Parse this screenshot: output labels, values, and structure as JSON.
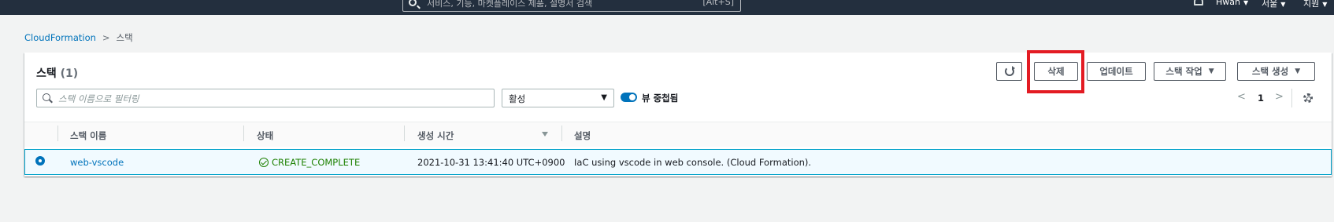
{
  "topnav": {
    "search_placeholder": "서비스, 기능, 마켓플레이스 제품, 설명서 검색",
    "search_shortcut": "[Alt+S]",
    "user": "Hwan",
    "region": "서울",
    "support": "지원"
  },
  "breadcrumb": {
    "root": "CloudFormation",
    "current": "스택"
  },
  "panel": {
    "title": "스택",
    "count": "(1)",
    "buttons": {
      "delete": "삭제",
      "update": "업데이트",
      "stack_actions": "스택 작업",
      "create_stack": "스택 생성"
    },
    "filter_placeholder": "스택 이름으로 필터링",
    "status_filter": "활성",
    "toggle_label": "뷰 중첩됨",
    "page": "1"
  },
  "table": {
    "headers": [
      "스택 이름",
      "상태",
      "생성 시간",
      "설명"
    ],
    "rows": [
      {
        "name": "web-vscode",
        "status": "CREATE_COMPLETE",
        "created": "2021-10-31 13:41:40 UTC+0900",
        "description": "IaC using vscode in web console. (Cloud Formation)."
      }
    ]
  },
  "colors": {
    "nav_bg": "#232f3e",
    "link": "#0073bb",
    "success": "#1d8102",
    "highlight": "#e31b23",
    "selected_row": "#f1faff"
  }
}
